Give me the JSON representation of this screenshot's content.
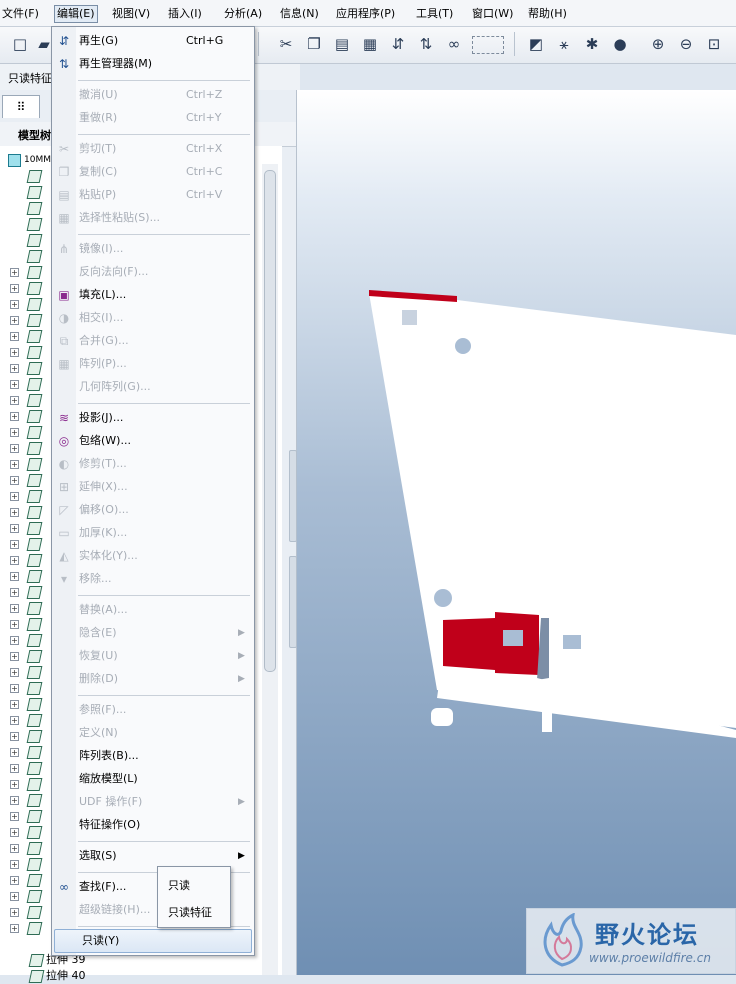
{
  "menubar": {
    "items": [
      "文件(F)",
      "编辑(E)",
      "视图(V)",
      "插入(I)",
      "分析(A)",
      "信息(N)",
      "应用程序(P)",
      "工具(T)",
      "窗口(W)",
      "帮助(H)"
    ],
    "active": "编辑(E)"
  },
  "filter": {
    "label": "只读特征"
  },
  "left_panel": {
    "tree_title": "模型树",
    "root": "10MM",
    "visible_items": [
      "拉伸 39",
      "拉伸 40"
    ]
  },
  "edit_menu": {
    "items": [
      {
        "label": "再生(G)",
        "shortcut": "Ctrl+G",
        "enabled": true,
        "icon": "regenerate-icon"
      },
      {
        "label": "再生管理器(M)",
        "shortcut": "",
        "enabled": true,
        "icon": "regen-manager-icon"
      },
      {
        "label": "撤消(U)",
        "shortcut": "Ctrl+Z",
        "enabled": false,
        "icon": ""
      },
      {
        "label": "重做(R)",
        "shortcut": "Ctrl+Y",
        "enabled": false,
        "icon": ""
      },
      {
        "label": "剪切(T)",
        "shortcut": "Ctrl+X",
        "enabled": false,
        "icon": "scissors-icon"
      },
      {
        "label": "复制(C)",
        "shortcut": "Ctrl+C",
        "enabled": false,
        "icon": "copy-icon"
      },
      {
        "label": "粘贴(P)",
        "shortcut": "Ctrl+V",
        "enabled": false,
        "icon": "paste-icon"
      },
      {
        "label": "选择性粘贴(S)...",
        "shortcut": "",
        "enabled": false,
        "icon": "paste-special-icon"
      },
      {
        "label": "镜像(I)...",
        "shortcut": "",
        "enabled": false,
        "icon": "mirror-icon"
      },
      {
        "label": "反向法向(F)...",
        "shortcut": "",
        "enabled": false,
        "icon": ""
      },
      {
        "label": "填充(L)...",
        "shortcut": "",
        "enabled": true,
        "icon": "fill-icon"
      },
      {
        "label": "相交(I)...",
        "shortcut": "",
        "enabled": false,
        "icon": "intersect-icon"
      },
      {
        "label": "合并(G)...",
        "shortcut": "",
        "enabled": false,
        "icon": "merge-icon"
      },
      {
        "label": "阵列(P)...",
        "shortcut": "",
        "enabled": false,
        "icon": "pattern-icon"
      },
      {
        "label": "几何阵列(G)...",
        "shortcut": "",
        "enabled": false,
        "icon": ""
      },
      {
        "label": "投影(J)...",
        "shortcut": "",
        "enabled": true,
        "icon": "project-icon"
      },
      {
        "label": "包络(W)...",
        "shortcut": "",
        "enabled": true,
        "icon": "wrap-icon"
      },
      {
        "label": "修剪(T)...",
        "shortcut": "",
        "enabled": false,
        "icon": "trim-icon"
      },
      {
        "label": "延伸(X)...",
        "shortcut": "",
        "enabled": false,
        "icon": "extend-icon"
      },
      {
        "label": "偏移(O)...",
        "shortcut": "",
        "enabled": false,
        "icon": "offset-icon"
      },
      {
        "label": "加厚(K)...",
        "shortcut": "",
        "enabled": false,
        "icon": "thicken-icon"
      },
      {
        "label": "实体化(Y)...",
        "shortcut": "",
        "enabled": false,
        "icon": "solidify-icon"
      },
      {
        "label": "移除...",
        "shortcut": "",
        "enabled": false,
        "icon": "remove-icon"
      },
      {
        "label": "替换(A)...",
        "shortcut": "",
        "enabled": false,
        "icon": ""
      },
      {
        "label": "隐含(E)",
        "shortcut": "",
        "enabled": false,
        "icon": "",
        "submenu": true
      },
      {
        "label": "恢复(U)",
        "shortcut": "",
        "enabled": false,
        "icon": "",
        "submenu": true
      },
      {
        "label": "删除(D)",
        "shortcut": "",
        "enabled": false,
        "icon": "",
        "submenu": true
      },
      {
        "label": "参照(F)...",
        "shortcut": "",
        "enabled": false,
        "icon": ""
      },
      {
        "label": "定义(N)",
        "shortcut": "",
        "enabled": false,
        "icon": ""
      },
      {
        "label": "阵列表(B)...",
        "shortcut": "",
        "enabled": true,
        "icon": ""
      },
      {
        "label": "缩放模型(L)",
        "shortcut": "",
        "enabled": true,
        "icon": ""
      },
      {
        "label": "UDF 操作(F)",
        "shortcut": "",
        "enabled": false,
        "icon": "",
        "submenu": true
      },
      {
        "label": "特征操作(O)",
        "shortcut": "",
        "enabled": true,
        "icon": ""
      },
      {
        "label": "选取(S)",
        "shortcut": "",
        "enabled": true,
        "icon": "",
        "submenu": true
      },
      {
        "label": "查找(F)...",
        "shortcut": "",
        "enabled": true,
        "icon": "binoculars-icon"
      },
      {
        "label": "超级链接(H)...",
        "shortcut": "",
        "enabled": false,
        "icon": ""
      },
      {
        "label": "只读(Y)",
        "shortcut": "",
        "enabled": true,
        "icon": "",
        "highlighted": true
      }
    ]
  },
  "readonly_submenu": {
    "items": [
      "只读",
      "只读特征"
    ]
  },
  "watermark": {
    "title": "野火论坛",
    "url": "www.proewildfire.cn"
  },
  "colors": {
    "menu_bg": "#f9fafc",
    "highlight": "#dbe7f5",
    "model_red": "#c0001a",
    "viewport_top": "#ffffff",
    "viewport_bottom": "#6f8fb3"
  }
}
